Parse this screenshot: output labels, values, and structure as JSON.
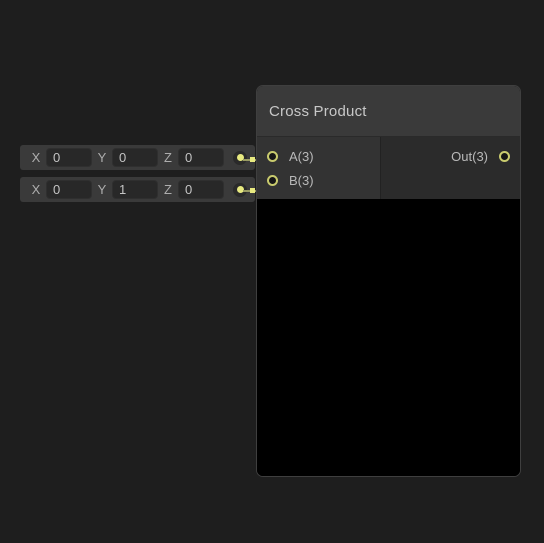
{
  "theme": {
    "canvas_bg": "#1e1e1e",
    "node_header_bg": "#3a3a3a",
    "node_body_bg": "#000000",
    "port_column_in_bg": "#333333",
    "port_column_out_bg": "#2b2b2b",
    "wire_color": "#9a9c63",
    "socket_accent": "#e8ea80",
    "ring_accent": "#c9cb6e",
    "label_color": "#b9b9b9",
    "title_color": "#c8c8c8"
  },
  "node": {
    "title": "Cross Product",
    "inputs": [
      {
        "label": "A(3)",
        "socket_icon": "port-ring-icon",
        "connected": true
      },
      {
        "label": "B(3)",
        "socket_icon": "port-ring-icon",
        "connected": true
      }
    ],
    "outputs": [
      {
        "label": "Out(3)",
        "socket_icon": "port-ring-icon",
        "connected": false
      }
    ],
    "preview": {
      "content": "",
      "background": "#000000"
    }
  },
  "vector_inputs": [
    {
      "name": "vector-a",
      "components": [
        {
          "axis": "X",
          "value": "0"
        },
        {
          "axis": "Y",
          "value": "0"
        },
        {
          "axis": "Z",
          "value": "0"
        }
      ],
      "output_socket_icon": "socket-dot-icon",
      "placeholder": "0"
    },
    {
      "name": "vector-b",
      "components": [
        {
          "axis": "X",
          "value": "0"
        },
        {
          "axis": "Y",
          "value": "1"
        },
        {
          "axis": "Z",
          "value": "0"
        }
      ],
      "output_socket_icon": "socket-dot-icon",
      "placeholder": "0"
    }
  ],
  "connections": [
    {
      "from": "vector-a.out",
      "to": "cross-product.A(3)"
    },
    {
      "from": "vector-b.out",
      "to": "cross-product.B(3)"
    }
  ]
}
